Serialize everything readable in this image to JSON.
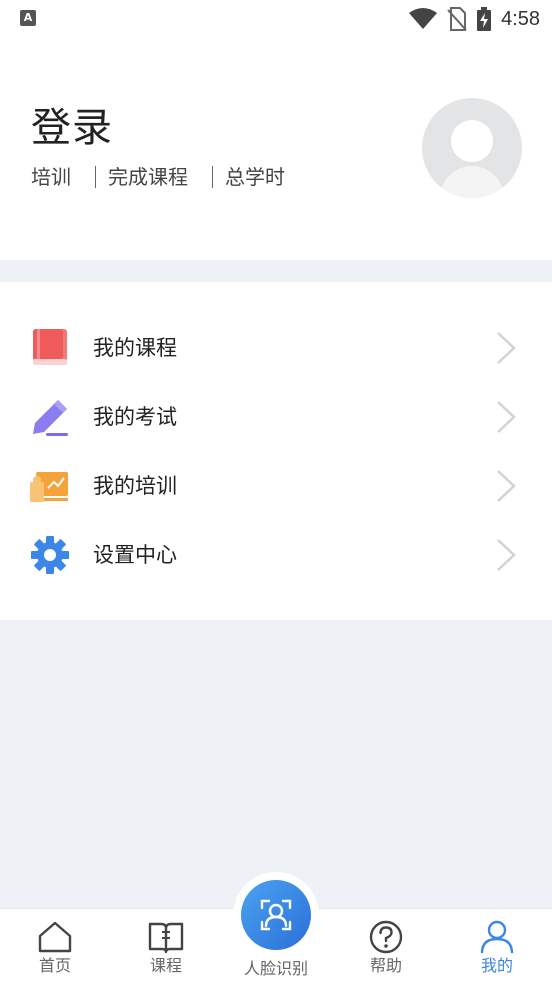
{
  "status_bar": {
    "time": "4:58",
    "app_indicator": "A",
    "icons": [
      "wifi-icon",
      "no-sim-icon",
      "battery-charging-icon"
    ]
  },
  "profile": {
    "login_label": "登录",
    "stats": [
      "培训",
      "完成课程",
      "总学时"
    ]
  },
  "menu": {
    "items": [
      {
        "label": "我的课程",
        "icon": "book-icon",
        "color": "#ef5b5b"
      },
      {
        "label": "我的考试",
        "icon": "pencil-icon",
        "color": "#7b6cf0"
      },
      {
        "label": "我的培训",
        "icon": "training-icon",
        "color": "#f5a23a"
      },
      {
        "label": "设置中心",
        "icon": "gear-icon",
        "color": "#3b86e6"
      }
    ]
  },
  "bottom_nav": {
    "items": [
      {
        "label": "首页",
        "icon": "home-icon"
      },
      {
        "label": "课程",
        "icon": "open-book-icon"
      },
      {
        "label": "人脸识别",
        "icon": "face-scan-icon"
      },
      {
        "label": "帮助",
        "icon": "help-icon"
      },
      {
        "label": "我的",
        "icon": "user-icon",
        "active": true
      }
    ],
    "active_color": "#3b86e6"
  }
}
